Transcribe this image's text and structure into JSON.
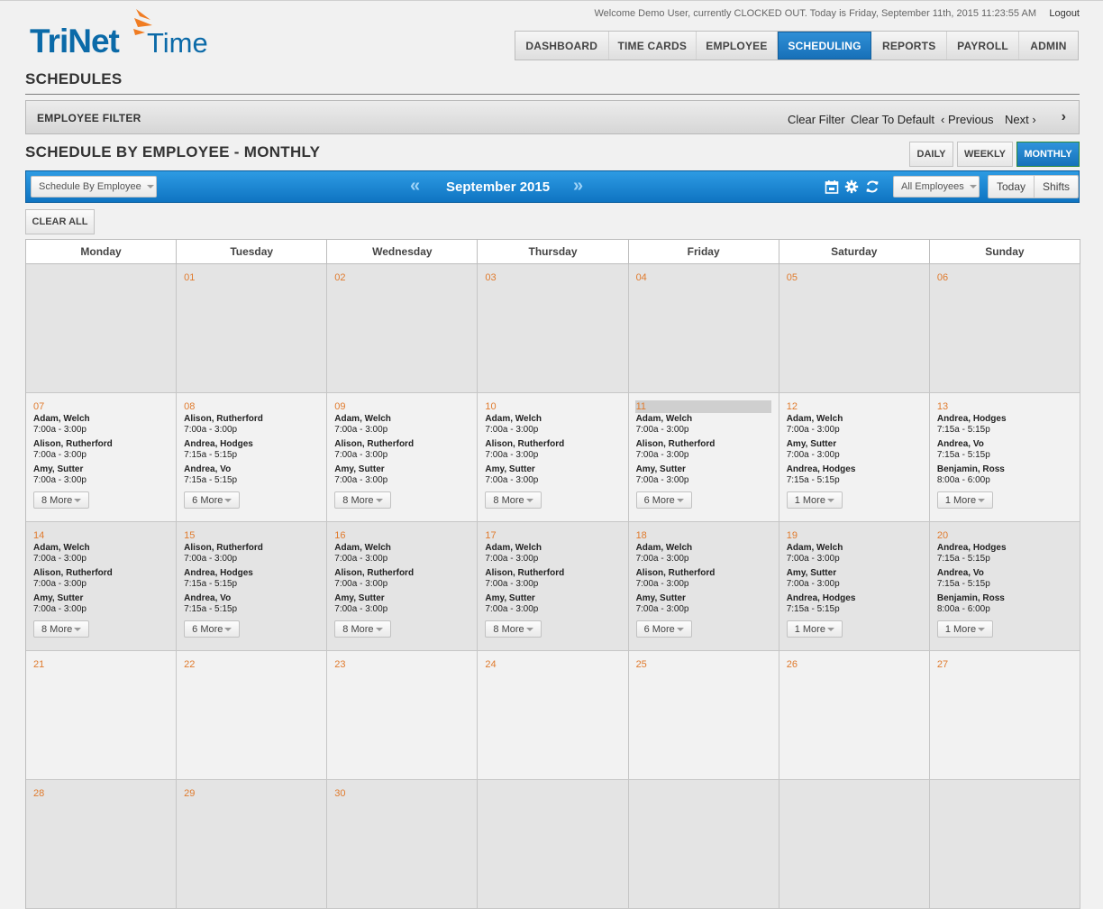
{
  "header": {
    "brand": "TriNet",
    "product": "Time",
    "welcome": "Welcome Demo User, currently CLOCKED OUT. Today is Friday, September 11th, 2015 11:23:55 AM",
    "logout": "Logout",
    "brand_color": "#0b6aa8",
    "accent_color": "#f07c22"
  },
  "nav": {
    "items": [
      {
        "label": "DASHBOARD",
        "w": 104
      },
      {
        "label": "TIME CARDS",
        "w": 98
      },
      {
        "label": "EMPLOYEE",
        "w": 90
      },
      {
        "label": "SCHEDULING",
        "w": 104,
        "active": true
      },
      {
        "label": "REPORTS",
        "w": 84
      },
      {
        "label": "PAYROLL",
        "w": 80
      },
      {
        "label": "ADMIN",
        "w": 66
      }
    ]
  },
  "page": {
    "title": "SCHEDULES"
  },
  "filter": {
    "label": "EMPLOYEE FILTER",
    "clear_filter": "Clear Filter",
    "clear_default": "Clear To Default",
    "previous": "Previous",
    "next": "Next"
  },
  "schedule": {
    "title": "SCHEDULE BY EMPLOYEE - MONTHLY",
    "views": [
      {
        "label": "DAILY",
        "w": 49
      },
      {
        "label": "WEEKLY",
        "w": 62
      },
      {
        "label": "MONTHLY",
        "w": 70,
        "active": true
      }
    ],
    "view_select": "Schedule By Employee",
    "month": "September 2015",
    "employee_select": "All Employees",
    "today": "Today",
    "shifts": "Shifts",
    "clear_all": "CLEAR ALL"
  },
  "calendar": {
    "weekdays": [
      "Monday",
      "Tuesday",
      "Wednesday",
      "Thursday",
      "Friday",
      "Saturday",
      "Sunday"
    ],
    "weeks": [
      {
        "shade": true,
        "days": [
          {
            "num": ""
          },
          {
            "num": "01"
          },
          {
            "num": "02"
          },
          {
            "num": "03"
          },
          {
            "num": "04"
          },
          {
            "num": "05"
          },
          {
            "num": "06"
          }
        ]
      },
      {
        "shade": false,
        "days": [
          {
            "num": "07",
            "entries": [
              {
                "name": "Adam, Welch",
                "time": "7:00a - 3:00p"
              },
              {
                "name": "Alison, Rutherford",
                "time": "7:00a - 3:00p"
              },
              {
                "name": "Amy, Sutter",
                "time": "7:00a - 3:00p"
              }
            ],
            "more": "8 More"
          },
          {
            "num": "08",
            "entries": [
              {
                "name": "Alison, Rutherford",
                "time": "7:00a - 3:00p"
              },
              {
                "name": "Andrea, Hodges",
                "time": "7:15a - 5:15p"
              },
              {
                "name": "Andrea, Vo",
                "time": "7:15a - 5:15p"
              }
            ],
            "more": "6 More"
          },
          {
            "num": "09",
            "entries": [
              {
                "name": "Adam, Welch",
                "time": "7:00a - 3:00p"
              },
              {
                "name": "Alison, Rutherford",
                "time": "7:00a - 3:00p"
              },
              {
                "name": "Amy, Sutter",
                "time": "7:00a - 3:00p"
              }
            ],
            "more": "8 More"
          },
          {
            "num": "10",
            "entries": [
              {
                "name": "Adam, Welch",
                "time": "7:00a - 3:00p"
              },
              {
                "name": "Alison, Rutherford",
                "time": "7:00a - 3:00p"
              },
              {
                "name": "Amy, Sutter",
                "time": "7:00a - 3:00p"
              }
            ],
            "more": "8 More"
          },
          {
            "num": "11",
            "today": true,
            "entries": [
              {
                "name": "Adam, Welch",
                "time": "7:00a - 3:00p"
              },
              {
                "name": "Alison, Rutherford",
                "time": "7:00a - 3:00p"
              },
              {
                "name": "Amy, Sutter",
                "time": "7:00a - 3:00p"
              }
            ],
            "more": "6 More"
          },
          {
            "num": "12",
            "entries": [
              {
                "name": "Adam, Welch",
                "time": "7:00a - 3:00p"
              },
              {
                "name": "Amy, Sutter",
                "time": "7:00a - 3:00p"
              },
              {
                "name": "Andrea, Hodges",
                "time": "7:15a - 5:15p"
              }
            ],
            "more": "1 More"
          },
          {
            "num": "13",
            "entries": [
              {
                "name": "Andrea, Hodges",
                "time": "7:15a - 5:15p"
              },
              {
                "name": "Andrea, Vo",
                "time": "7:15a - 5:15p"
              },
              {
                "name": "Benjamin, Ross",
                "time": "8:00a - 6:00p"
              }
            ],
            "more": "1 More"
          }
        ]
      },
      {
        "shade": true,
        "days": [
          {
            "num": "14",
            "entries": [
              {
                "name": "Adam, Welch",
                "time": "7:00a - 3:00p"
              },
              {
                "name": "Alison, Rutherford",
                "time": "7:00a - 3:00p"
              },
              {
                "name": "Amy, Sutter",
                "time": "7:00a - 3:00p"
              }
            ],
            "more": "8 More"
          },
          {
            "num": "15",
            "entries": [
              {
                "name": "Alison, Rutherford",
                "time": "7:00a - 3:00p"
              },
              {
                "name": "Andrea, Hodges",
                "time": "7:15a - 5:15p"
              },
              {
                "name": "Andrea, Vo",
                "time": "7:15a - 5:15p"
              }
            ],
            "more": "6 More"
          },
          {
            "num": "16",
            "entries": [
              {
                "name": "Adam, Welch",
                "time": "7:00a - 3:00p"
              },
              {
                "name": "Alison, Rutherford",
                "time": "7:00a - 3:00p"
              },
              {
                "name": "Amy, Sutter",
                "time": "7:00a - 3:00p"
              }
            ],
            "more": "8 More"
          },
          {
            "num": "17",
            "entries": [
              {
                "name": "Adam, Welch",
                "time": "7:00a - 3:00p"
              },
              {
                "name": "Alison, Rutherford",
                "time": "7:00a - 3:00p"
              },
              {
                "name": "Amy, Sutter",
                "time": "7:00a - 3:00p"
              }
            ],
            "more": "8 More"
          },
          {
            "num": "18",
            "entries": [
              {
                "name": "Adam, Welch",
                "time": "7:00a - 3:00p"
              },
              {
                "name": "Alison, Rutherford",
                "time": "7:00a - 3:00p"
              },
              {
                "name": "Amy, Sutter",
                "time": "7:00a - 3:00p"
              }
            ],
            "more": "6 More"
          },
          {
            "num": "19",
            "entries": [
              {
                "name": "Adam, Welch",
                "time": "7:00a - 3:00p"
              },
              {
                "name": "Amy, Sutter",
                "time": "7:00a - 3:00p"
              },
              {
                "name": "Andrea, Hodges",
                "time": "7:15a - 5:15p"
              }
            ],
            "more": "1 More"
          },
          {
            "num": "20",
            "entries": [
              {
                "name": "Andrea, Hodges",
                "time": "7:15a - 5:15p"
              },
              {
                "name": "Andrea, Vo",
                "time": "7:15a - 5:15p"
              },
              {
                "name": "Benjamin, Ross",
                "time": "8:00a - 6:00p"
              }
            ],
            "more": "1 More"
          }
        ]
      },
      {
        "shade": false,
        "days": [
          {
            "num": "21"
          },
          {
            "num": "22"
          },
          {
            "num": "23"
          },
          {
            "num": "24"
          },
          {
            "num": "25"
          },
          {
            "num": "26"
          },
          {
            "num": "27"
          }
        ]
      },
      {
        "shade": true,
        "days": [
          {
            "num": "28"
          },
          {
            "num": "29"
          },
          {
            "num": "30"
          },
          {
            "num": ""
          },
          {
            "num": ""
          },
          {
            "num": ""
          },
          {
            "num": ""
          }
        ]
      }
    ]
  }
}
